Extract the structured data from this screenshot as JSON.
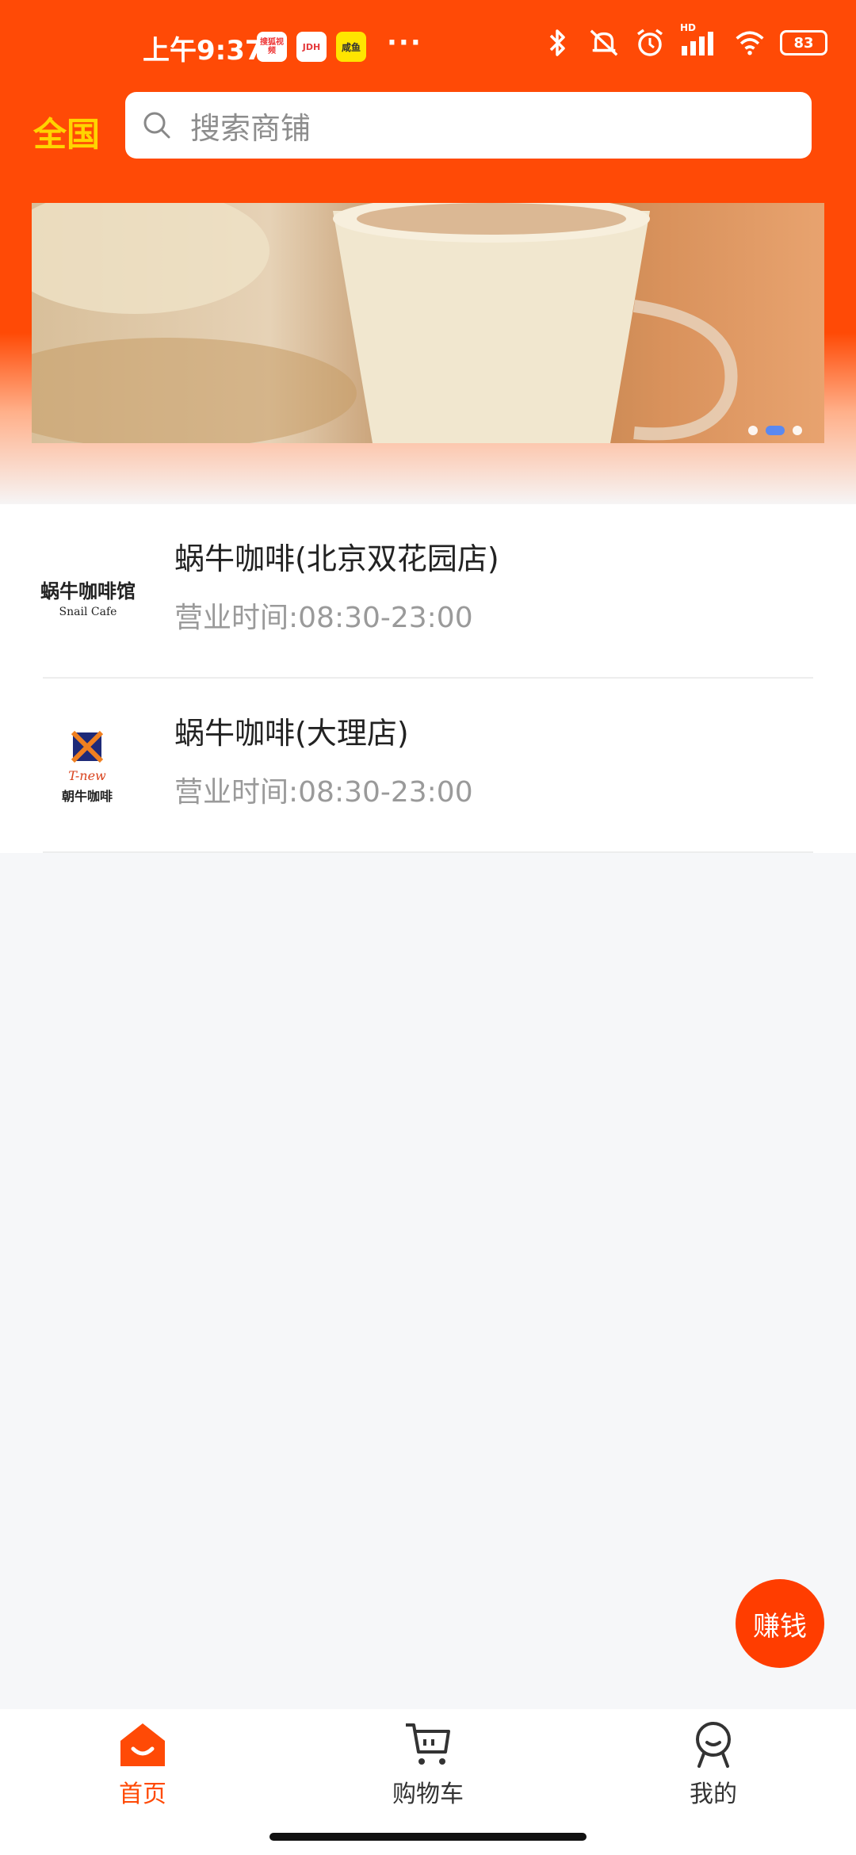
{
  "status_bar": {
    "time": "上午9:37",
    "badges": [
      "搜狐视频",
      "JDH",
      "咸鱼"
    ],
    "overflow": "···",
    "network": "HD",
    "battery": "83"
  },
  "header": {
    "region": "全国",
    "search_placeholder": "搜索商铺"
  },
  "banner": {
    "slide_count": 3,
    "active_index": 1
  },
  "stores": [
    {
      "name": "蜗牛咖啡(北京双花园店)",
      "hours": "营业时间:08:30-23:00",
      "logo_text": "蜗牛咖啡馆",
      "logo_sub": "Snail Cafe"
    },
    {
      "name": "蜗牛咖啡(大理店)",
      "hours": "营业时间:08:30-23:00",
      "logo_text": "朝牛咖啡",
      "logo_sub": "T-new"
    }
  ],
  "fab": {
    "label": "赚钱"
  },
  "tabs": [
    {
      "label": "首页",
      "active": true
    },
    {
      "label": "购物车",
      "active": false
    },
    {
      "label": "我的",
      "active": false
    }
  ],
  "colors": {
    "brand": "#ff4a06",
    "accent_yellow": "#ffd400",
    "active_tab": "#ff4a06",
    "inactive_tab": "#333333"
  }
}
